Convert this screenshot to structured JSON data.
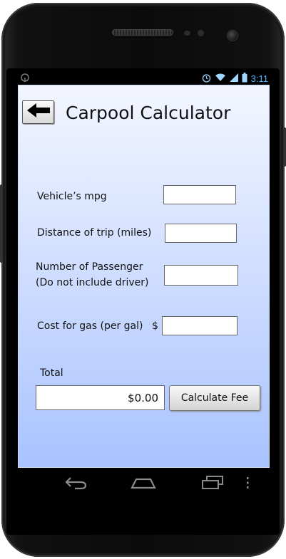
{
  "status_bar": {
    "time": "3:11",
    "icons": [
      "alarm-icon",
      "wifi-icon",
      "signal-icon",
      "battery-icon"
    ]
  },
  "app": {
    "title": "Carpool Calculator"
  },
  "form": {
    "mpg_label": "Vehicle’s mpg",
    "mpg_value": "",
    "distance_label": "Distance of trip (miles)",
    "distance_value": "",
    "passengers_label_line1": "Number of Passenger",
    "passengers_label_line2": "(Do not include driver)",
    "passengers_value": "",
    "gas_cost_label": "Cost for gas (per gal)",
    "gas_currency": "$",
    "gas_cost_value": "",
    "total_label": "Total",
    "total_value": "$0.00",
    "calculate_label": "Calculate Fee"
  },
  "navigation": {
    "icons": [
      "back-nav-icon",
      "home-nav-icon",
      "recent-apps-icon",
      "menu-icon"
    ]
  },
  "colors": {
    "screen_top": "#f3f6ff",
    "screen_bottom": "#a9c3ff",
    "status_accent": "#4fb4ff"
  }
}
